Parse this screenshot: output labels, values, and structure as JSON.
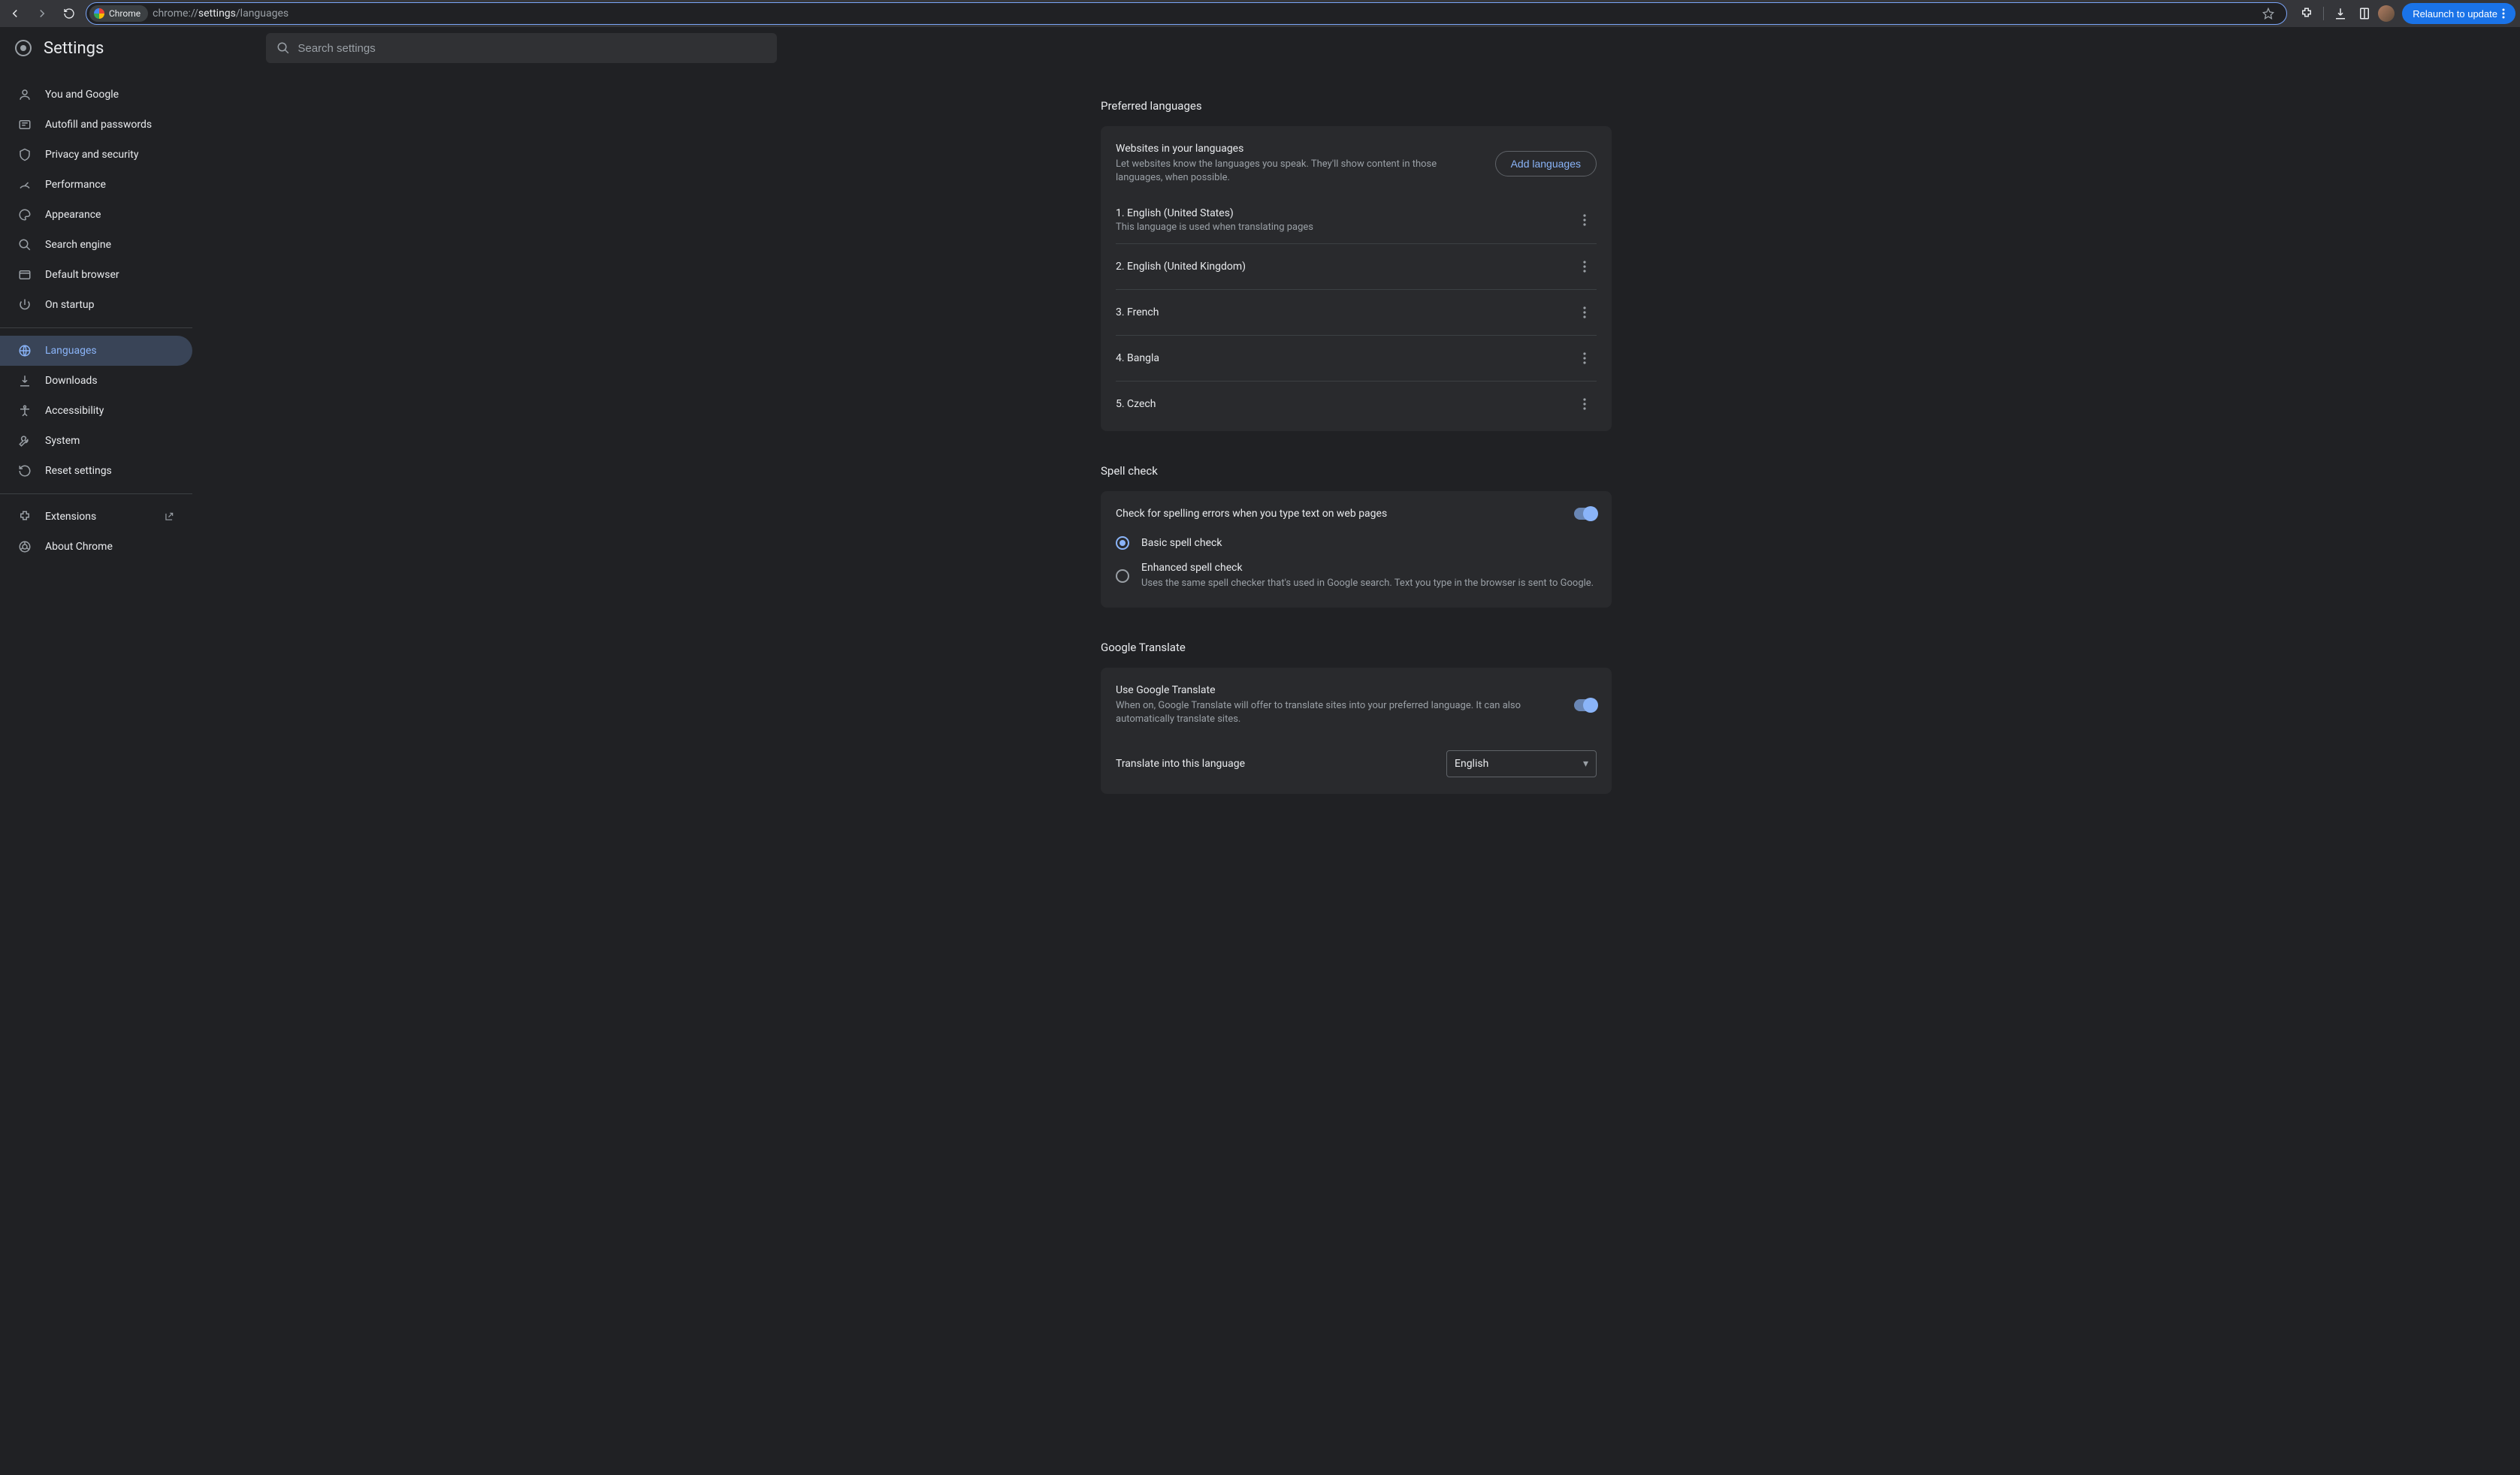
{
  "toolbar": {
    "chip_label": "Chrome",
    "url_pre": "chrome://",
    "url_mid": "settings",
    "url_post": "/languages",
    "relaunch_label": "Relaunch to update"
  },
  "header": {
    "title": "Settings",
    "search_placeholder": "Search settings"
  },
  "sidebar": {
    "items": [
      {
        "icon": "person",
        "label": "You and Google"
      },
      {
        "icon": "autofill",
        "label": "Autofill and passwords"
      },
      {
        "icon": "shield",
        "label": "Privacy and security"
      },
      {
        "icon": "speed",
        "label": "Performance"
      },
      {
        "icon": "palette",
        "label": "Appearance"
      },
      {
        "icon": "search",
        "label": "Search engine"
      },
      {
        "icon": "browser",
        "label": "Default browser"
      },
      {
        "icon": "power",
        "label": "On startup"
      }
    ],
    "items2": [
      {
        "icon": "globe",
        "label": "Languages",
        "active": true
      },
      {
        "icon": "download",
        "label": "Downloads"
      },
      {
        "icon": "a11y",
        "label": "Accessibility"
      },
      {
        "icon": "wrench",
        "label": "System"
      },
      {
        "icon": "reset",
        "label": "Reset settings"
      }
    ],
    "items3": [
      {
        "icon": "extension",
        "label": "Extensions",
        "external": true
      },
      {
        "icon": "chrome",
        "label": "About Chrome"
      }
    ]
  },
  "preferred": {
    "section": "Preferred languages",
    "websites_title": "Websites in your languages",
    "websites_sub": "Let websites know the languages you speak. They'll show content in those languages, when possible.",
    "add_btn": "Add languages",
    "langs": [
      {
        "n": "1.",
        "name": "English (United States)",
        "sub": "This language is used when translating pages"
      },
      {
        "n": "2.",
        "name": "English (United Kingdom)"
      },
      {
        "n": "3.",
        "name": "French"
      },
      {
        "n": "4.",
        "name": "Bangla"
      },
      {
        "n": "5.",
        "name": "Czech"
      }
    ]
  },
  "spell": {
    "section": "Spell check",
    "toggle_label": "Check for spelling errors when you type text on web pages",
    "basic": "Basic spell check",
    "enhanced": "Enhanced spell check",
    "enhanced_sub": "Uses the same spell checker that's used in Google search. Text you type in the browser is sent to Google."
  },
  "translate": {
    "section": "Google Translate",
    "use_title": "Use Google Translate",
    "use_sub": "When on, Google Translate will offer to translate sites into your preferred language. It can also automatically translate sites.",
    "into_label": "Translate into this language",
    "into_value": "English"
  }
}
